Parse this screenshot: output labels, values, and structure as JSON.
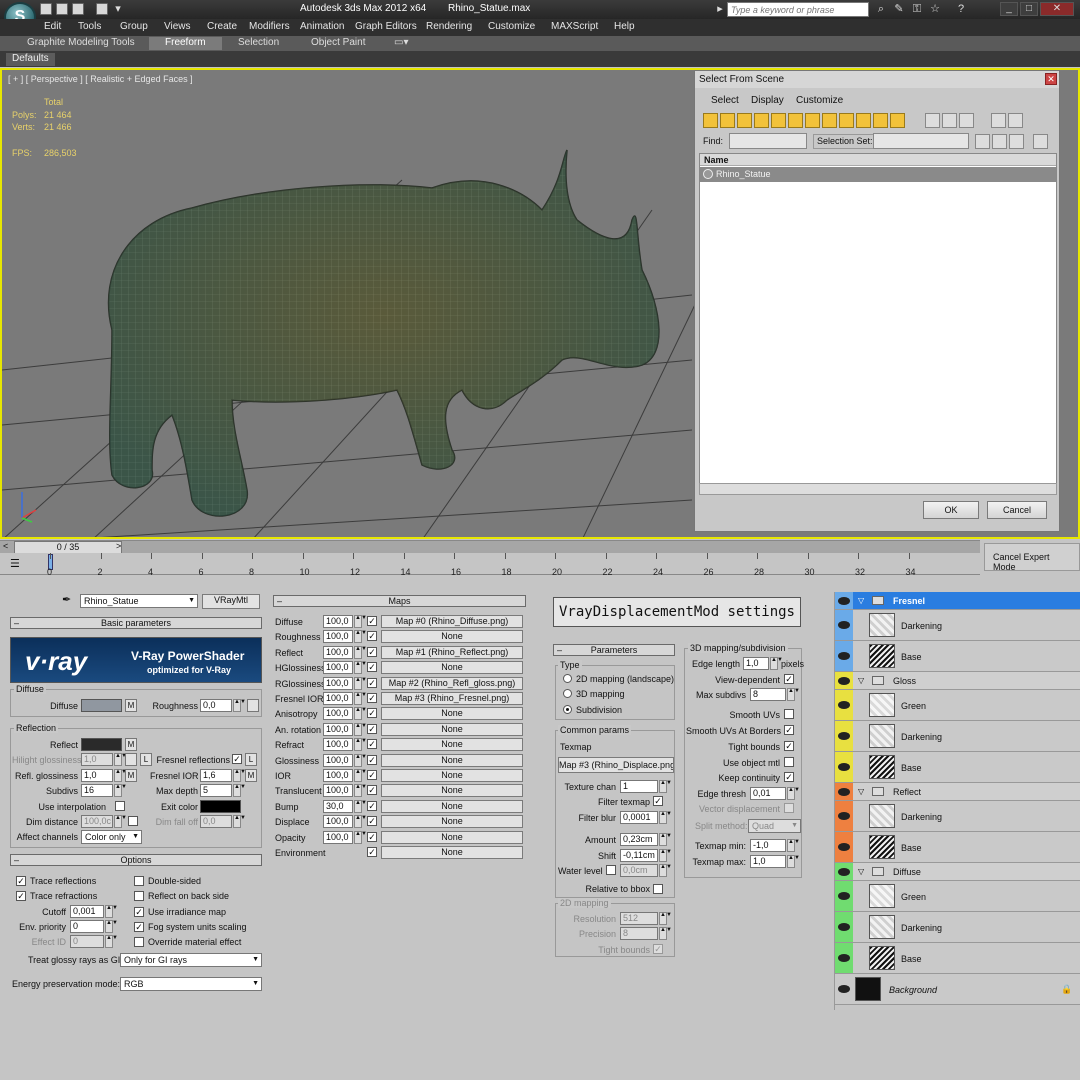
{
  "app": {
    "title": "Autodesk 3ds Max  2012 x64",
    "file": "Rhino_Statue.max",
    "logo_letter": "S",
    "search_placeholder": "Type a keyword or phrase"
  },
  "menu": [
    "Edit",
    "Tools",
    "Group",
    "Views",
    "Create",
    "Modifiers",
    "Animation",
    "Graph Editors",
    "Rendering",
    "Customize",
    "MAXScript",
    "Help"
  ],
  "ribbon": {
    "tabs": [
      "Graphite Modeling Tools",
      "Freeform",
      "Selection",
      "Object Paint"
    ],
    "active": "Freeform",
    "defaults": "Defaults"
  },
  "viewport": {
    "label": "[ + ] [ Perspective ] [ Realistic + Edged Faces ]",
    "stats": {
      "total_label": "Total",
      "polys_label": "Polys:",
      "polys": "21 464",
      "verts_label": "Verts:",
      "verts": "21 466",
      "fps_label": "FPS:",
      "fps": "286,503"
    }
  },
  "select_from_scene": {
    "title": "Select From Scene",
    "menu": [
      "Select",
      "Display",
      "Customize"
    ],
    "find_label": "Find:",
    "selection_set_label": "Selection Set:",
    "column_name": "Name",
    "objects": [
      "Rhino_Statue"
    ],
    "ok": "OK",
    "cancel": "Cancel"
  },
  "timeline": {
    "frame": "0 / 35",
    "ticks": [
      "0",
      "2",
      "4",
      "6",
      "8",
      "10",
      "12",
      "14",
      "16",
      "18",
      "20",
      "22",
      "24",
      "26",
      "28",
      "30",
      "32",
      "34"
    ],
    "cancel_expert": "Cancel Expert Mode"
  },
  "material": {
    "name": "Rhino_Statue",
    "type": "VRayMtl",
    "basic_rollout": "Basic parameters",
    "logo_text": "v·ray",
    "logo_title": "V-Ray PowerShader",
    "logo_sub": "optimized for V-Ray",
    "diffuse_group": "Diffuse",
    "diffuse_label": "Diffuse",
    "roughness_label": "Roughness",
    "roughness": "0,0",
    "reflection_group": "Reflection",
    "reflect_label": "Reflect",
    "hilight_label": "Hilight glossiness",
    "hilight": "1,0",
    "refl_gloss_label": "Refl. glossiness",
    "refl_gloss": "1,0",
    "subdivs_label": "Subdivs",
    "subdivs": "16",
    "use_interp_label": "Use interpolation",
    "dim_distance_label": "Dim distance",
    "dim_distance": "100,0c",
    "affect_channels_label": "Affect channels",
    "affect_channels": "Color only",
    "fresnel_label": "Fresnel reflections",
    "fresnel_ior_label": "Fresnel IOR",
    "fresnel_ior": "1,6",
    "max_depth_label": "Max depth",
    "max_depth": "5",
    "exit_color_label": "Exit color",
    "dim_falloff_label": "Dim fall off",
    "dim_falloff": "0,0",
    "m": "M",
    "l": "L",
    "options_rollout": "Options",
    "trace_reflections": "Trace reflections",
    "trace_refractions": "Trace refractions",
    "cutoff_label": "Cutoff",
    "cutoff": "0,001",
    "env_priority_label": "Env. priority",
    "env_priority": "0",
    "effect_id_label": "Effect ID",
    "effect_id": "0",
    "double_sided": "Double-sided",
    "reflect_backside": "Reflect on back side",
    "use_irradiance": "Use irradiance map",
    "fog_units": "Fog system units scaling",
    "override_effect": "Override material effect",
    "glossy_gi_label": "Treat glossy rays as GI",
    "glossy_gi": "Only for GI rays",
    "energy_label": "Energy preservation mode:",
    "energy": "RGB"
  },
  "maps": {
    "title": "Maps",
    "rows": [
      {
        "name": "Diffuse",
        "amount": "100,0",
        "map": "Map #0 (Rhino_Diffuse.png)"
      },
      {
        "name": "Roughness",
        "amount": "100,0",
        "map": "None"
      },
      {
        "name": "Reflect",
        "amount": "100,0",
        "map": "Map #1 (Rhino_Reflect.png)"
      },
      {
        "name": "HGlossiness",
        "amount": "100,0",
        "map": "None"
      },
      {
        "name": "RGlossiness",
        "amount": "100,0",
        "map": "Map #2 (Rhino_Refl_gloss.png)"
      },
      {
        "name": "Fresnel IOR",
        "amount": "100,0",
        "map": "Map #3 (Rhino_Fresnel.png)"
      },
      {
        "name": "Anisotropy",
        "amount": "100,0",
        "map": "None"
      },
      {
        "name": "An. rotation",
        "amount": "100,0",
        "map": "None"
      },
      {
        "name": "Refract",
        "amount": "100,0",
        "map": "None"
      },
      {
        "name": "Glossiness",
        "amount": "100,0",
        "map": "None"
      },
      {
        "name": "IOR",
        "amount": "100,0",
        "map": "None"
      },
      {
        "name": "Translucent",
        "amount": "100,0",
        "map": "None"
      },
      {
        "name": "Bump",
        "amount": "30,0",
        "map": "None"
      },
      {
        "name": "Displace",
        "amount": "100,0",
        "map": "None"
      },
      {
        "name": "Opacity",
        "amount": "100,0",
        "map": "None"
      },
      {
        "name": "Environment",
        "amount": "",
        "map": "None"
      }
    ]
  },
  "displacement": {
    "title": "VrayDisplacementMod settings",
    "params_rollout": "Parameters",
    "type_group": "Type",
    "type_options": [
      "2D mapping (landscape)",
      "3D mapping",
      "Subdivision"
    ],
    "type_selected": "Subdivision",
    "common_group": "Common params",
    "texmap_label": "Texmap",
    "texmap": "Map #3 (Rhino_Displace.png)",
    "texture_chan_label": "Texture chan",
    "texture_chan": "1",
    "filter_texmap_label": "Filter texmap",
    "filter_blur_label": "Filter blur",
    "filter_blur": "0,0001",
    "amount_label": "Amount",
    "amount": "0,23cm",
    "shift_label": "Shift",
    "shift": "-0,11cm",
    "water_level_label": "Water level",
    "water_level": "0,0cm",
    "relative_bbox_label": "Relative to bbox",
    "map2d_group": "2D mapping",
    "resolution_label": "Resolution",
    "resolution": "512",
    "precision_label": "Precision",
    "precision": "8",
    "tight_bounds2d_label": "Tight bounds",
    "map3d_group": "3D mapping/subdivision",
    "edge_length_label": "Edge length",
    "edge_length": "1,0",
    "pixels_label": "pixels",
    "view_dependent_label": "View-dependent",
    "max_subdivs_label": "Max subdivs",
    "max_subdivs": "8",
    "smooth_uvs_label": "Smooth UVs",
    "smooth_uvs_borders_label": "Smooth UVs At Borders",
    "tight_bounds_label": "Tight bounds",
    "use_object_mtl_label": "Use object mtl",
    "keep_continuity_label": "Keep continuity",
    "edge_thresh_label": "Edge thresh",
    "edge_thresh": "0,01",
    "vector_disp_label": "Vector displacement",
    "split_method_label": "Split method:",
    "split_method": "Quad",
    "texmap_min_label": "Texmap min:",
    "texmap_min": "-1,0",
    "texmap_max_label": "Texmap max:",
    "texmap_max": "1,0"
  },
  "layers": {
    "groups": [
      {
        "name": "Fresnel",
        "color": "#6aaae8",
        "layers": [
          "Darkening",
          "Base"
        ]
      },
      {
        "name": "Gloss",
        "color": "#e8e040",
        "layers": [
          "Green",
          "Darkening",
          "Base"
        ]
      },
      {
        "name": "Reflect",
        "color": "#ee8040",
        "layers": [
          "Darkening",
          "Base"
        ]
      },
      {
        "name": "Diffuse",
        "color": "#70dc70",
        "layers": [
          "Green",
          "Darkening",
          "Base"
        ]
      }
    ],
    "background": "Background",
    "selected_color": "#2a7de0"
  }
}
